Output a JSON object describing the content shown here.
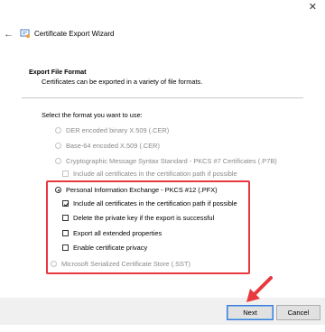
{
  "window": {
    "close_glyph": "✕",
    "back_glyph": "←"
  },
  "header": {
    "icon": "certificate-icon",
    "title": "Certificate Export Wizard"
  },
  "section": {
    "title": "Export File Format",
    "description": "Certificates can be exported in a variety of file formats."
  },
  "prompt": "Select the format you want to use:",
  "options": {
    "der": {
      "label": "DER encoded binary X.509 (.CER)",
      "enabled": false,
      "selected": false
    },
    "base64": {
      "label": "Base-64 encoded X.509 (.CER)",
      "enabled": false,
      "selected": false
    },
    "p7b": {
      "label": "Cryptographic Message Syntax Standard - PKCS #7 Certificates (.P7B)",
      "enabled": false,
      "selected": false
    },
    "p7b_include": {
      "label": "Include all certificates in the certification path if possible",
      "enabled": false,
      "checked": false
    },
    "pfx": {
      "label": "Personal Information Exchange - PKCS #12 (.PFX)",
      "enabled": true,
      "selected": true
    },
    "pfx_include": {
      "label": "Include all certificates in the certification path if possible",
      "enabled": true,
      "checked": true
    },
    "pfx_delete_key": {
      "label": "Delete the private key if the export is successful",
      "enabled": true,
      "checked": false
    },
    "pfx_export_props": {
      "label": "Export all extended properties",
      "enabled": true,
      "checked": false
    },
    "pfx_privacy": {
      "label": "Enable certificate privacy",
      "enabled": true,
      "checked": false
    },
    "sst": {
      "label": "Microsoft Serialized Certificate Store (.SST)",
      "enabled": false,
      "selected": false
    }
  },
  "footer": {
    "next_label": "Next",
    "cancel_label": "Cancel"
  },
  "colors": {
    "annotation": "#e8393f",
    "footer_bg": "#f0f0f0",
    "disabled_text": "#8a8a8a",
    "accent_border": "#3b7ad9"
  }
}
